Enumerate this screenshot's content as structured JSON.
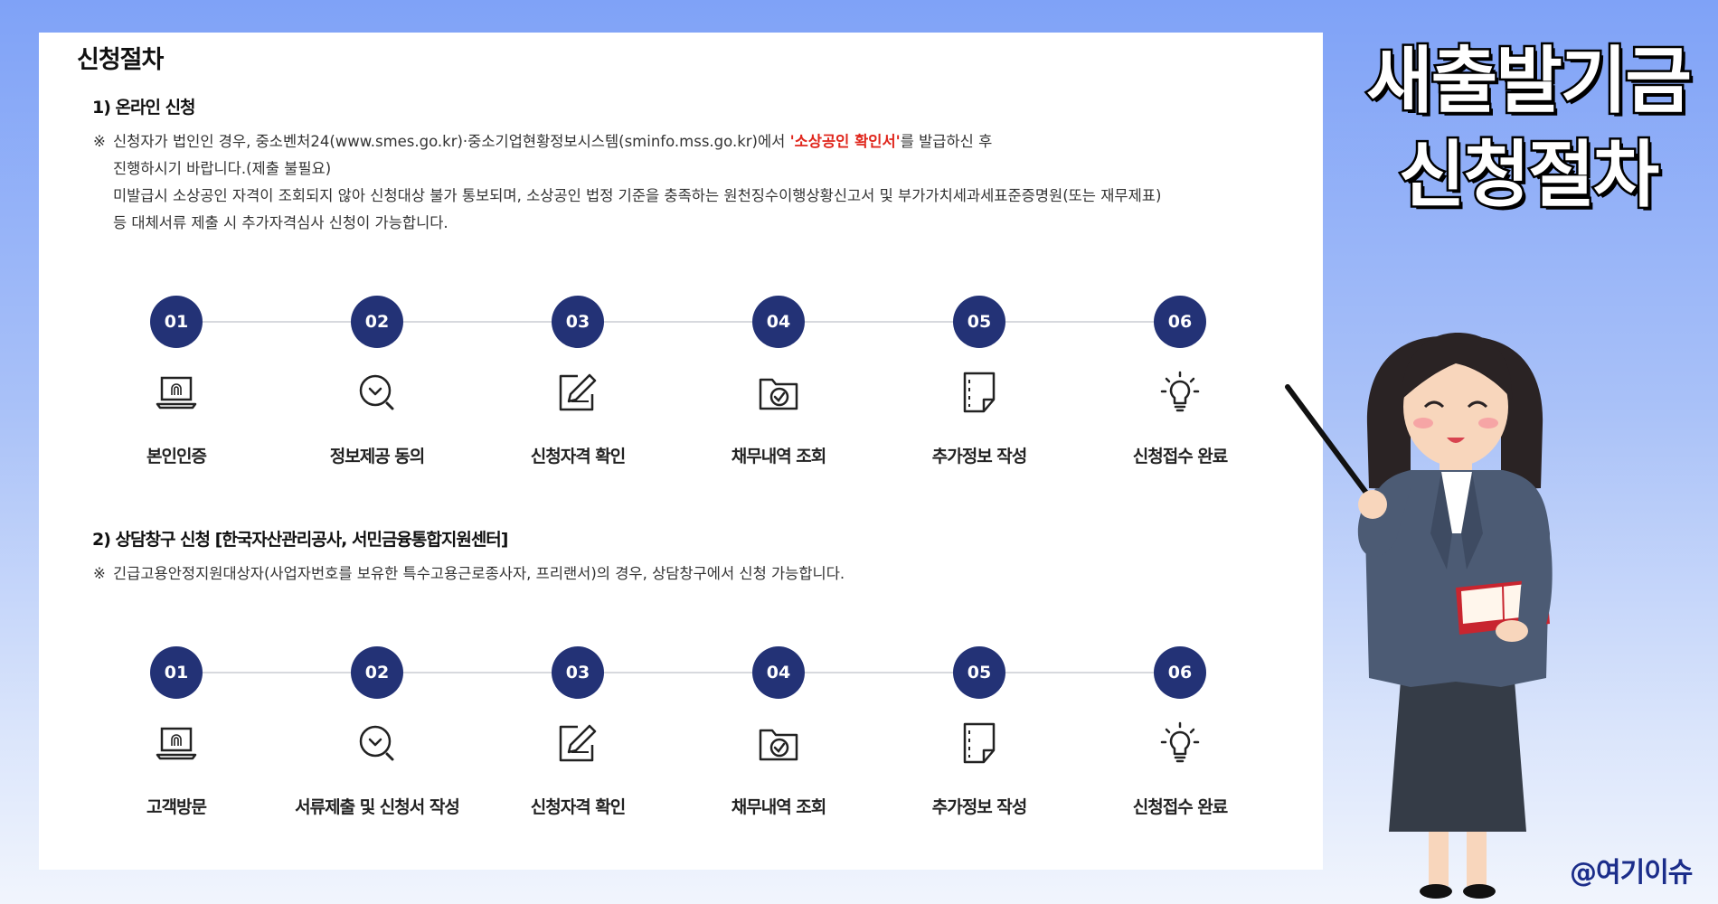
{
  "panel": {
    "title": "신청절차",
    "section1": {
      "title": "1) 온라인 신청",
      "notice_mark": "※",
      "notice_lines": [
        {
          "pre": "신청자가 법인인 경우, 중소벤처24(www.smes.go.kr)·중소기업현황정보시스템(sminfo.mss.go.kr)에서 ",
          "highlight": "'소상공인 확인서'",
          "post": "를 발급하신 후"
        },
        {
          "pre": "진행하시기 바랍니다.(제출 불필요)",
          "highlight": "",
          "post": ""
        },
        {
          "pre": "미발급시 소상공인 자격이 조회되지 않아 신청대상 불가 통보되며, 소상공인 법정 기준을 충족하는 원천징수이행상황신고서 및 부가가치세과세표준증명원(또는 재무제표)",
          "highlight": "",
          "post": ""
        },
        {
          "pre": "등 대체서류 제출 시 추가자격심사 신청이 가능합니다.",
          "highlight": "",
          "post": ""
        }
      ],
      "steps": [
        {
          "num": "01",
          "icon": "laptop-fingerprint-icon",
          "label": "본인인증"
        },
        {
          "num": "02",
          "icon": "search-check-icon",
          "label": "정보제공 동의"
        },
        {
          "num": "03",
          "icon": "edit-document-icon",
          "label": "신청자격 확인"
        },
        {
          "num": "04",
          "icon": "folder-check-icon",
          "label": "채무내역 조회"
        },
        {
          "num": "05",
          "icon": "document-icon",
          "label": "추가정보 작성"
        },
        {
          "num": "06",
          "icon": "lightbulb-icon",
          "label": "신청접수 완료"
        }
      ]
    },
    "section2": {
      "title": "2) 상담창구 신청 [한국자산관리공사, 서민금융통합지원센터]",
      "notice_mark": "※",
      "notice_lines": [
        {
          "pre": "긴급고용안정지원대상자(사업자번호를 보유한 특수고용근로종사자, 프리랜서)의 경우, 상담창구에서 신청 가능합니다.",
          "highlight": "",
          "post": ""
        }
      ],
      "steps": [
        {
          "num": "01",
          "icon": "laptop-fingerprint-icon",
          "label": "고객방문"
        },
        {
          "num": "02",
          "icon": "search-check-icon",
          "label": "서류제출 및 신청서 작성"
        },
        {
          "num": "03",
          "icon": "edit-document-icon",
          "label": "신청자격 확인"
        },
        {
          "num": "04",
          "icon": "folder-check-icon",
          "label": "채무내역 조회"
        },
        {
          "num": "05",
          "icon": "document-icon",
          "label": "추가정보 작성"
        },
        {
          "num": "06",
          "icon": "lightbulb-icon",
          "label": "신청접수 완료"
        }
      ]
    }
  },
  "overlay": {
    "title_line1": "새출발기금",
    "title_line2": "신청절차",
    "handle": "@여기이슈"
  },
  "colors": {
    "step_circle": "#233276",
    "highlight_red": "#e0261c",
    "handle_blue": "#1b2d8a"
  }
}
